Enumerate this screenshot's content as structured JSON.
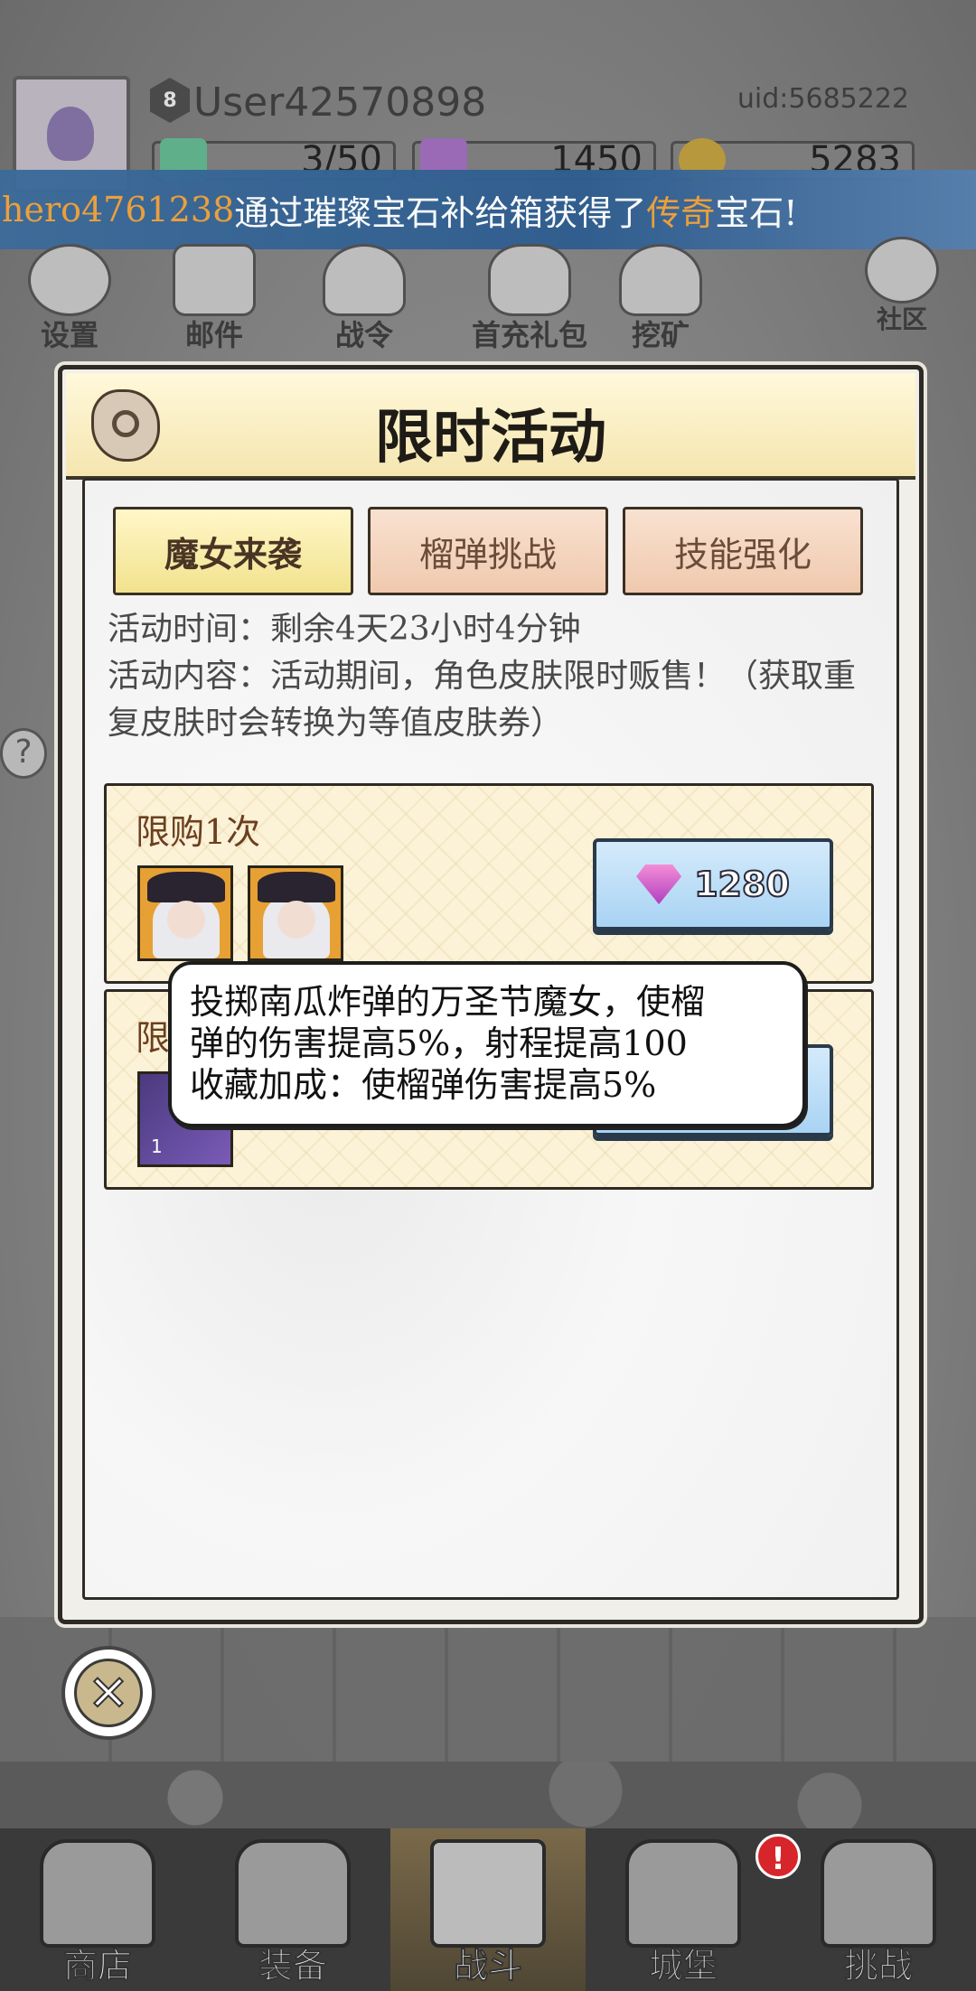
{
  "header": {
    "level": "8",
    "username": "User42570898",
    "uid": "uid:5685222",
    "resources": [
      {
        "icon": "green-crystal-icon",
        "value": "3/50"
      },
      {
        "icon": "purple-gem-icon",
        "value": "1450"
      },
      {
        "icon": "gold-coin-icon",
        "value": "5283"
      }
    ]
  },
  "banner": {
    "player": "hero4761238",
    "text_before": "通过璀璨宝石补给箱获得了 ",
    "rarity": "传奇",
    "text_after": " 宝石!"
  },
  "top_icons": [
    {
      "label": "设置",
      "icon": "gear-icon"
    },
    {
      "label": "邮件",
      "icon": "mail-icon"
    },
    {
      "label": "战令",
      "icon": "battle-pass-icon"
    },
    {
      "label": "首充礼包",
      "icon": "gift-bag-icon"
    },
    {
      "label": "挖矿",
      "icon": "mining-icon"
    },
    {
      "label": "社区",
      "icon": "home-icon"
    }
  ],
  "dialog": {
    "title": "限时活动",
    "tabs": [
      {
        "label": "魔女来袭",
        "active": true
      },
      {
        "label": "榴弹挑战",
        "active": false
      },
      {
        "label": "技能强化",
        "active": false
      }
    ],
    "time_text": "活动时间：剩余4天23小时4分钟",
    "content_text": "活动内容：活动期间，角色皮肤限时贩售！（获取重复皮肤时会转换为等值皮肤券）",
    "cards": [
      {
        "limit": "限购1次",
        "price": "1280"
      },
      {
        "limit": "限",
        "ticket_count": "1"
      }
    ],
    "tooltip": {
      "line1": "投掷南瓜炸弹的万圣节魔女，使榴",
      "line2": "弹的伤害提高5%，射程提高100",
      "line3": "收藏加成：使榴弹伤害提高5%"
    }
  },
  "bottom_nav": [
    {
      "label": "商店",
      "icon": "shop-icon",
      "active": false
    },
    {
      "label": "装备",
      "icon": "backpack-icon",
      "active": false
    },
    {
      "label": "战斗",
      "icon": "crossed-swords-icon",
      "active": true
    },
    {
      "label": "城堡",
      "icon": "castle-icon",
      "active": false
    },
    {
      "label": "挑战",
      "icon": "challenge-icon",
      "active": false
    }
  ],
  "notification_badge": "!"
}
